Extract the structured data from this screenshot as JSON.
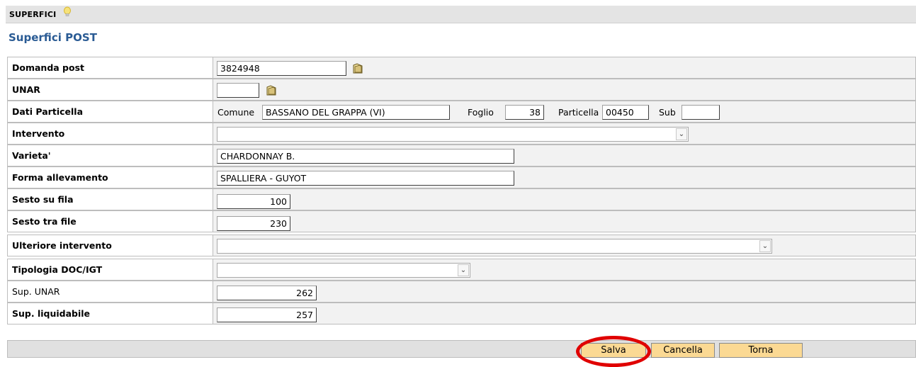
{
  "header": {
    "title": "SUPERFICI",
    "hint_icon": "lightbulb-icon"
  },
  "page": {
    "heading": "Superfici POST"
  },
  "form": {
    "domanda_post": {
      "label": "Domanda post",
      "value": "3824948"
    },
    "unar": {
      "label": "UNAR",
      "value": ""
    },
    "dati_particella": {
      "label": "Dati Particella",
      "comune_label": "Comune",
      "comune_value": "BASSANO DEL GRAPPA (VI)",
      "foglio_label": "Foglio",
      "foglio_value": "38",
      "particella_label": "Particella",
      "particella_value": "00450",
      "sub_label": "Sub",
      "sub_value": ""
    },
    "intervento": {
      "label": "Intervento",
      "value": ""
    },
    "varieta": {
      "label": "Varieta'",
      "value": "CHARDONNAY B."
    },
    "forma_allevamento": {
      "label": "Forma allevamento",
      "value": "SPALLIERA - GUYOT"
    },
    "sesto_su_fila": {
      "label": "Sesto su fila",
      "value": "100"
    },
    "sesto_tra_file": {
      "label": "Sesto tra file",
      "value": "230"
    },
    "ulteriore_intervento": {
      "label": "Ulteriore intervento",
      "value": ""
    },
    "tipologia_doc_igt": {
      "label": "Tipologia DOC/IGT",
      "value": ""
    },
    "sup_unar": {
      "label": "Sup. UNAR",
      "value": "262"
    },
    "sup_liquidabile": {
      "label": "Sup. liquidabile",
      "value": "257"
    }
  },
  "actions": {
    "salva": "Salva",
    "cancella": "Cancella",
    "torna": "Torna"
  },
  "colors": {
    "heading": "#2a5b94",
    "button": "#fbd993",
    "highlight": "#e00000"
  }
}
